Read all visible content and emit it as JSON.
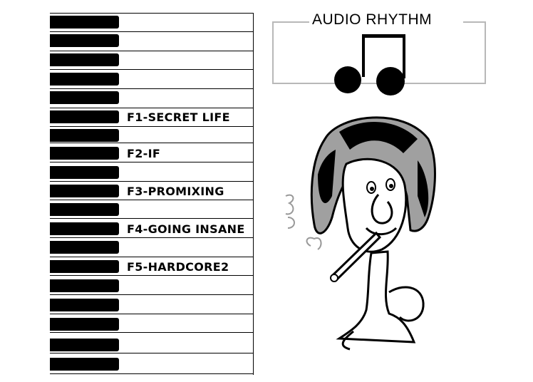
{
  "app_title": "AUDIO RHYTHM",
  "tracks": [
    {
      "label": "F1-SECRET LIFE"
    },
    {
      "label": "F2-IF"
    },
    {
      "label": "F3-PROMIXING"
    },
    {
      "label": "F4-GOING INSANE"
    },
    {
      "label": "F5-HARDCORE2"
    }
  ],
  "icons": {
    "note": "eighth-note-pair-icon",
    "mascot": "smoking-character-illustration"
  },
  "colors": {
    "background": "#ffffff",
    "keys": "#000000",
    "frame": "#b8b8b8",
    "hair_shade": "#a0a0a0"
  }
}
